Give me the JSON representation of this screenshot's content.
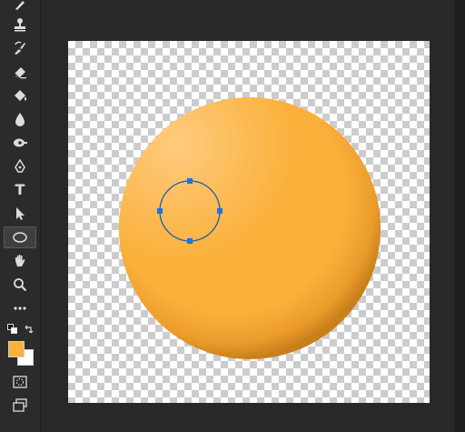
{
  "tools": [
    {
      "id": "brush",
      "icon": "brush-icon"
    },
    {
      "id": "clone-stamp",
      "icon": "stamp-icon"
    },
    {
      "id": "history-brush",
      "icon": "history-brush-icon"
    },
    {
      "id": "eraser",
      "icon": "eraser-icon"
    },
    {
      "id": "paint-bucket",
      "icon": "paint-bucket-icon"
    },
    {
      "id": "blur",
      "icon": "drop-icon"
    },
    {
      "id": "dodge",
      "icon": "dodge-icon"
    },
    {
      "id": "pen",
      "icon": "pen-icon"
    },
    {
      "id": "type",
      "icon": "type-icon"
    },
    {
      "id": "path-selection",
      "icon": "arrow-cursor-icon"
    },
    {
      "id": "ellipse",
      "icon": "ellipse-icon",
      "active": true
    },
    {
      "id": "hand",
      "icon": "hand-icon"
    },
    {
      "id": "zoom",
      "icon": "zoom-icon"
    },
    {
      "id": "more",
      "icon": "ellipsis-icon"
    }
  ],
  "type_tool_glyph": "T",
  "colors": {
    "foreground": "#fbb03b",
    "background": "#ffffff",
    "accent": "#1a73e8",
    "ui_dark": "#282828"
  },
  "canvas": {
    "button_fill": "#fbb03b",
    "selection_stroke": "#1b5fa8"
  }
}
